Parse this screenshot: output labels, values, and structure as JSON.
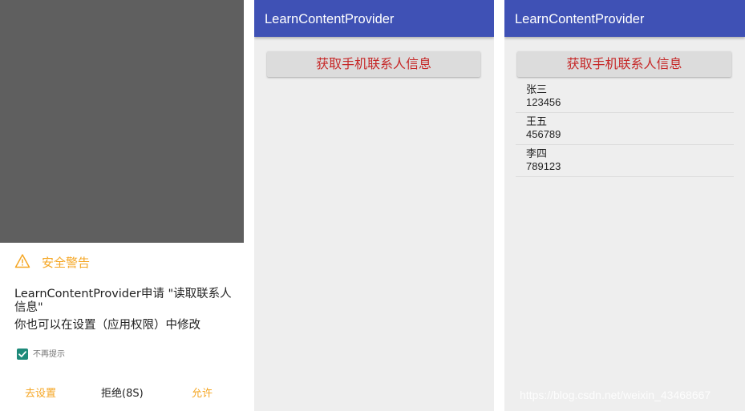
{
  "permission_screen": {
    "warning_title": "安全警告",
    "message_line1": "LearnContentProvider申请 \"读取联系人信息\"",
    "message_line2": "你也可以在设置（应用权限）中修改",
    "checkbox_label": "不再提示",
    "checkbox_checked": true,
    "buttons": {
      "settings": "去设置",
      "deny": "拒绝(8S)",
      "allow": "允许"
    },
    "accent_color": "#f5a623"
  },
  "app_screen_empty": {
    "title": "LearnContentProvider",
    "button_label": "获取手机联系人信息"
  },
  "app_screen_list": {
    "title": "LearnContentProvider",
    "button_label": "获取手机联系人信息",
    "contacts": [
      {
        "name": "张三",
        "number": "123456"
      },
      {
        "name": "王五",
        "number": "456789"
      },
      {
        "name": "李四",
        "number": "789123"
      }
    ]
  },
  "watermark": "https://blog.csdn.net/weixin_43468667",
  "colors": {
    "appbar": "#3f51b5",
    "button_text": "#c62828",
    "checkbox": "#1e8a7a"
  }
}
